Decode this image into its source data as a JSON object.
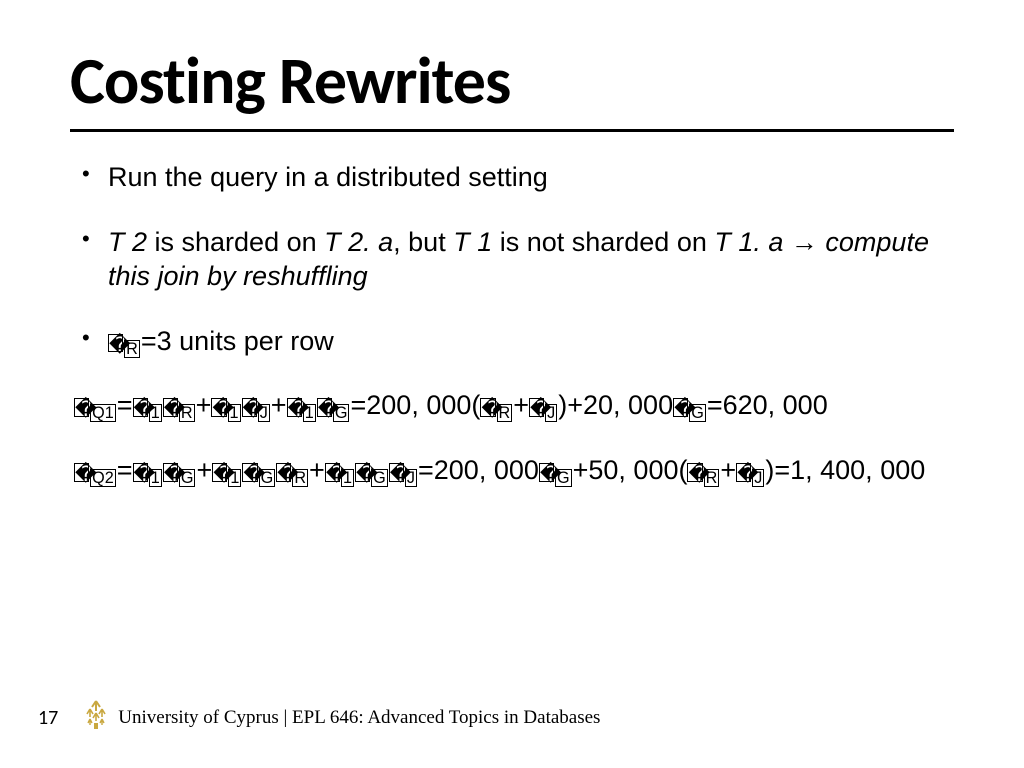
{
  "title": "Costing Rewrites",
  "bullets": {
    "b1": "Run the query in a distributed setting",
    "b2_prefix": "T 2",
    "b2_mid1": " is sharded on ",
    "b2_mid2": "T 2. a",
    "b2_mid3": ", but ",
    "b2_mid4": "T 1",
    "b2_mid5": " is not sharded on ",
    "b2_mid6": "T 1. a ",
    "b2_arrow": "→",
    "b2_tail": " compute this join by reshuffling",
    "b3_tail": "3 units per row"
  },
  "formulas": {
    "f1_tail": "00, 000(",
    "f1_mid": ")+20, 000",
    "f1_end": "=620, 000",
    "f2_mid1": "00, 000",
    "f2_mid2": "+50, 000(",
    "f2_end": ")=1, 400, 000"
  },
  "footer": {
    "page": "17",
    "text": "University of Cyprus | EPL 646: Advanced Topics in Databases"
  }
}
